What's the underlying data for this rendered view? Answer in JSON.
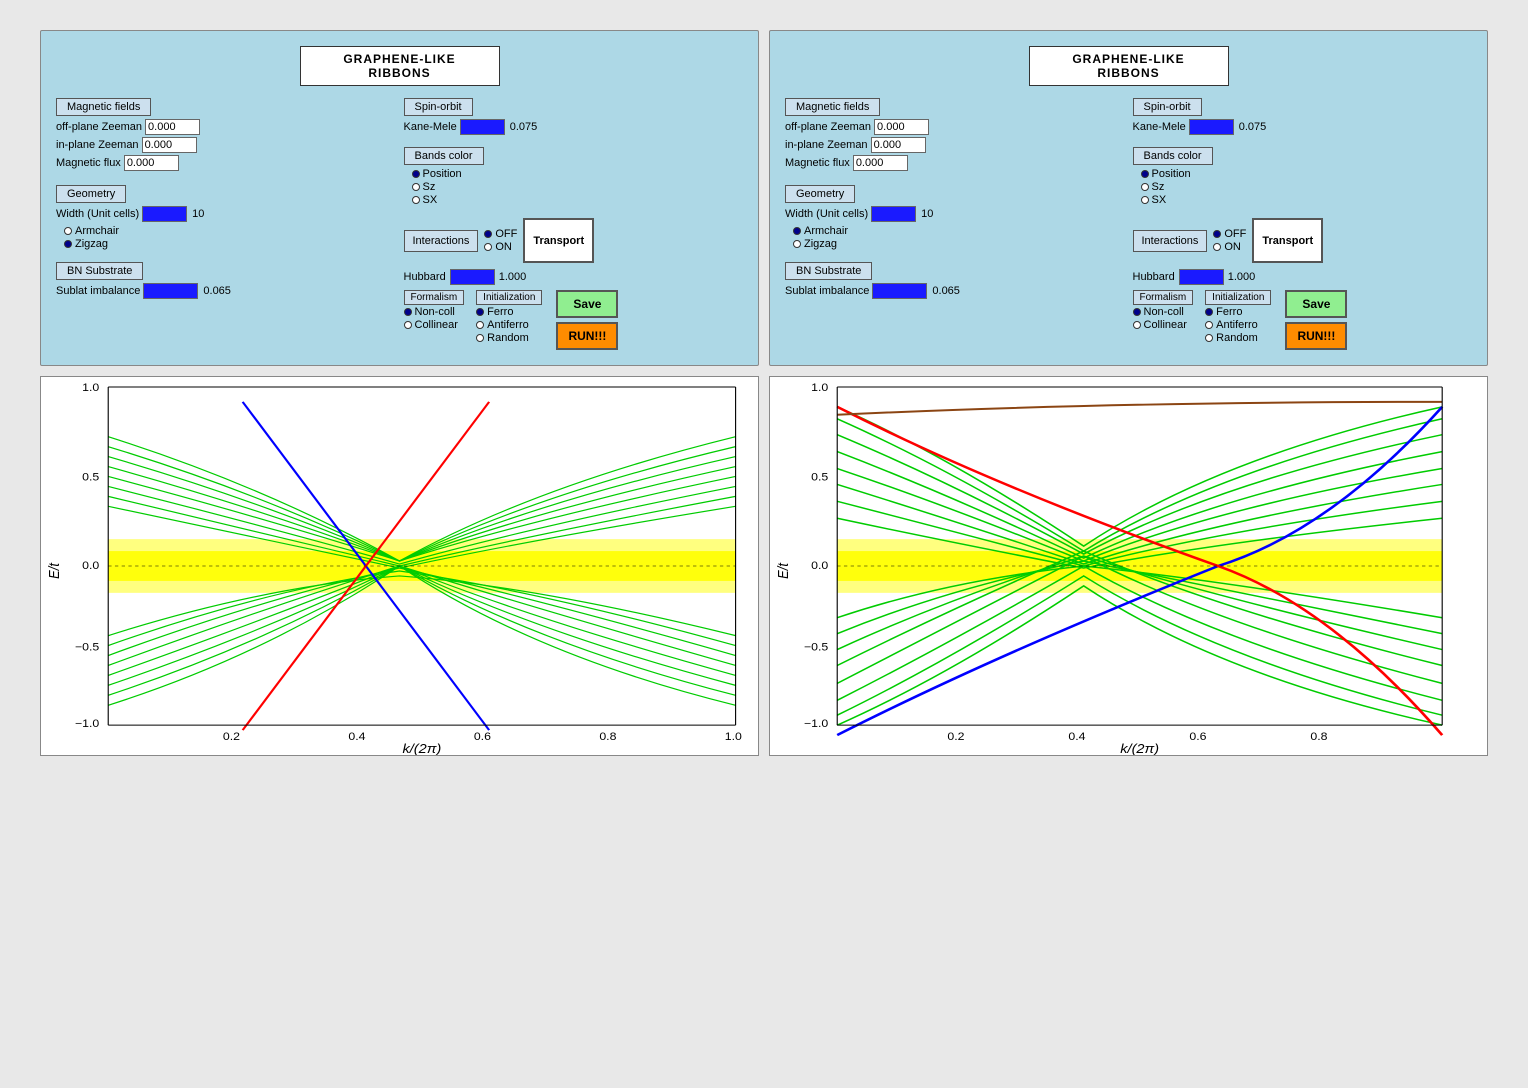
{
  "panels": [
    {
      "id": "left",
      "title": "GRAPHENE-LIKE RIBBONS",
      "magnetic_fields": {
        "label": "Magnetic fields",
        "off_plane_zeeman": {
          "label": "off-plane Zeeman",
          "value": "0.000"
        },
        "in_plane_zeeman": {
          "label": "in-plane Zeeman",
          "value": "0.000"
        },
        "magnetic_flux": {
          "label": "Magnetic flux",
          "value": "0.000"
        }
      },
      "spin_orbit": {
        "label": "Spin-orbit",
        "kane_mele": {
          "label": "Kane-Mele",
          "value": "0.075"
        }
      },
      "bands_color": {
        "label": "Bands color",
        "options": [
          "Position",
          "Sz",
          "SX"
        ],
        "selected": 0
      },
      "geometry": {
        "label": "Geometry",
        "width_label": "Width (Unit cells)",
        "width_value": "10",
        "types": [
          "Armchair",
          "Zigzag"
        ],
        "selected": 1
      },
      "interactions": {
        "label": "Interactions",
        "off_label": "OFF",
        "on_label": "ON",
        "selected": "OFF",
        "hubbard_label": "Hubbard",
        "hubbard_value": "1.000"
      },
      "formalism": {
        "label": "Formalism",
        "options": [
          "Non-coll",
          "Collinear"
        ],
        "selected": 0
      },
      "initialization": {
        "label": "Initialization",
        "options": [
          "Ferro",
          "Antiferro",
          "Random"
        ],
        "selected": 0
      },
      "bn_substrate": {
        "label": "BN Substrate",
        "sublat_label": "Sublat imbalance",
        "sublat_value": "0.065"
      },
      "buttons": {
        "transport": "Transport",
        "save": "Save",
        "run": "RUN!!!"
      }
    },
    {
      "id": "right",
      "title": "GRAPHENE-LIKE RIBBONS",
      "magnetic_fields": {
        "label": "Magnetic fields",
        "off_plane_zeeman": {
          "label": "off-plane Zeeman",
          "value": "0.000"
        },
        "in_plane_zeeman": {
          "label": "in-plane Zeeman",
          "value": "0.000"
        },
        "magnetic_flux": {
          "label": "Magnetic flux",
          "value": "0.000"
        }
      },
      "spin_orbit": {
        "label": "Spin-orbit",
        "kane_mele": {
          "label": "Kane-Mele",
          "value": "0.075"
        }
      },
      "bands_color": {
        "label": "Bands color",
        "options": [
          "Position",
          "Sz",
          "SX"
        ],
        "selected": 0
      },
      "geometry": {
        "label": "Geometry",
        "width_label": "Width (Unit cells)",
        "width_value": "10",
        "types": [
          "Armchair",
          "Zigzag"
        ],
        "selected": 0
      },
      "interactions": {
        "label": "Interactions",
        "off_label": "OFF",
        "on_label": "ON",
        "selected": "OFF",
        "hubbard_label": "Hubbard",
        "hubbard_value": "1.000"
      },
      "formalism": {
        "label": "Formalism",
        "options": [
          "Non-coll",
          "Collinear"
        ],
        "selected": 0
      },
      "initialization": {
        "label": "Initialization",
        "options": [
          "Ferro",
          "Antiferro",
          "Random"
        ],
        "selected": 0
      },
      "bn_substrate": {
        "label": "BN Substrate",
        "sublat_label": "Sublat imbalance",
        "sublat_value": "0.065"
      },
      "buttons": {
        "transport": "Transport",
        "save": "Save",
        "run": "RUN!!!"
      }
    }
  ],
  "graphs": [
    {
      "id": "left-graph",
      "y_label": "E/t",
      "x_label": "k/(2π)",
      "x_ticks": [
        "0.2",
        "0.4",
        "0.6",
        "0.8",
        "1.0"
      ],
      "y_ticks": [
        "-1.0",
        "-0.5",
        "0.0",
        "0.5",
        "1.0"
      ]
    },
    {
      "id": "right-graph",
      "y_label": "E/t",
      "x_label": "k/(2π)",
      "x_ticks": [
        "0.2",
        "0.4",
        "0.6",
        "0.8"
      ],
      "y_ticks": [
        "-1.0",
        "-0.5",
        "0.0",
        "0.5",
        "1.0"
      ]
    }
  ]
}
